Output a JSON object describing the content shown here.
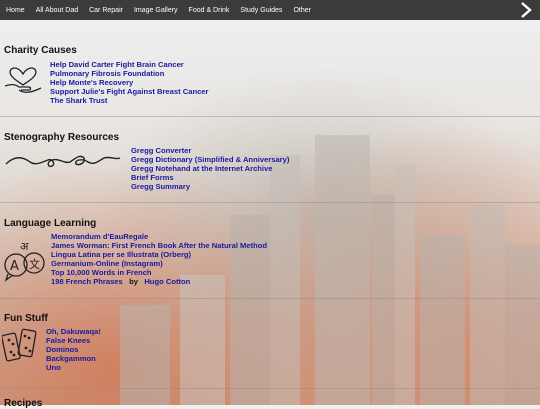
{
  "nav": {
    "items": [
      "Home",
      "All About Dad",
      "Car Repair",
      "Image Gallery",
      "Food & Drink",
      "Study Guides",
      "Other"
    ],
    "next_icon": "chevron-right-icon"
  },
  "sections": {
    "charity": {
      "title": "Charity Causes",
      "icon": "heart-in-hand-icon",
      "links": [
        "Help David Carter Fight Brain Cancer",
        "Pulmonary Fibrosis Foundation",
        "Help Monte's Recovery",
        "Support Julie's Fight Against Breast Cancer",
        "The Shark Trust"
      ]
    },
    "steno": {
      "title": "Stenography Resources",
      "icon": "shorthand-scribble-icon",
      "links": [
        "Gregg Converter",
        "Gregg Dictionary (Simplified & Anniversary)",
        "Gregg Notehand at the Internet Archive",
        "Brief Forms",
        "Gregg Summary"
      ]
    },
    "language": {
      "title": "Language Learning",
      "icon": "translate-speech-icon",
      "links": [
        "Memorandum d'EauRegale",
        "James Worman: First French Book After the Natural Method",
        "Lingua Latina per se Illustrata (Orberg)",
        "Germanium-Online (Instagram)",
        "Top 10,000 Words in French",
        "198 French Phrases"
      ],
      "by_text": "by",
      "author": "Hugo Cotton"
    },
    "fun": {
      "title": "Fun Stuff",
      "icon": "dominoes-icon",
      "links": [
        "Oh, Dakuwaqa!",
        "False Knees",
        "Dominos",
        "Backgammon",
        "Uno"
      ]
    },
    "recipes": {
      "title": "Recipes"
    }
  }
}
